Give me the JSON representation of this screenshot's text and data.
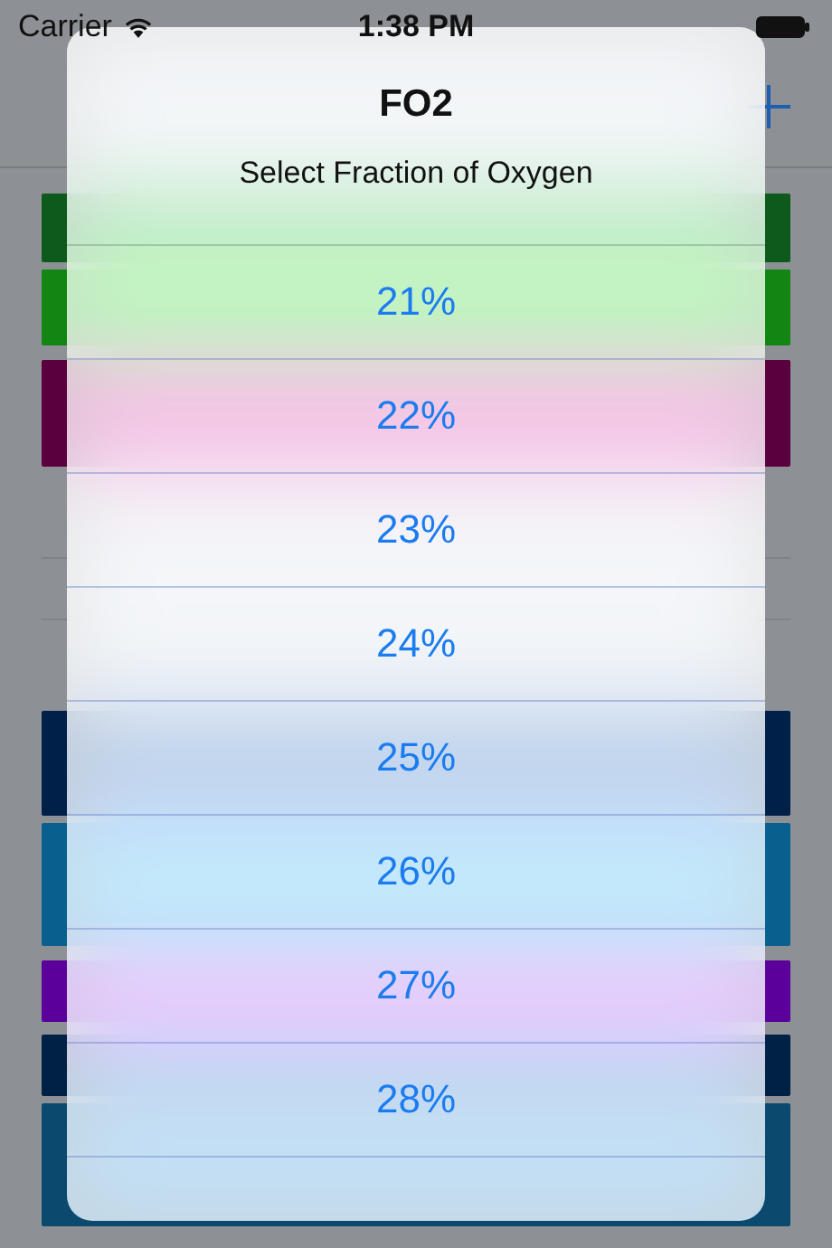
{
  "status_bar": {
    "carrier": "Carrier",
    "time": "1:38 PM"
  },
  "background_rows": [
    {
      "kind": "block",
      "color": "#0d5a1c"
    },
    {
      "kind": "block",
      "color": "#128512"
    },
    {
      "kind": "block",
      "color": "#5a003e"
    },
    {
      "kind": "blank"
    },
    {
      "kind": "blank"
    },
    {
      "kind": "blank"
    },
    {
      "kind": "block",
      "color": "#00204a"
    },
    {
      "kind": "block",
      "color": "#09608f"
    },
    {
      "kind": "block",
      "color": "#5c009c"
    },
    {
      "kind": "block",
      "color": "#002146"
    },
    {
      "kind": "block",
      "color": "#0b4a6e"
    }
  ],
  "sheet": {
    "title": "FO2",
    "subtitle": "Select Fraction of Oxygen",
    "options": [
      "21%",
      "22%",
      "23%",
      "24%",
      "25%",
      "26%",
      "27%",
      "28%"
    ]
  }
}
